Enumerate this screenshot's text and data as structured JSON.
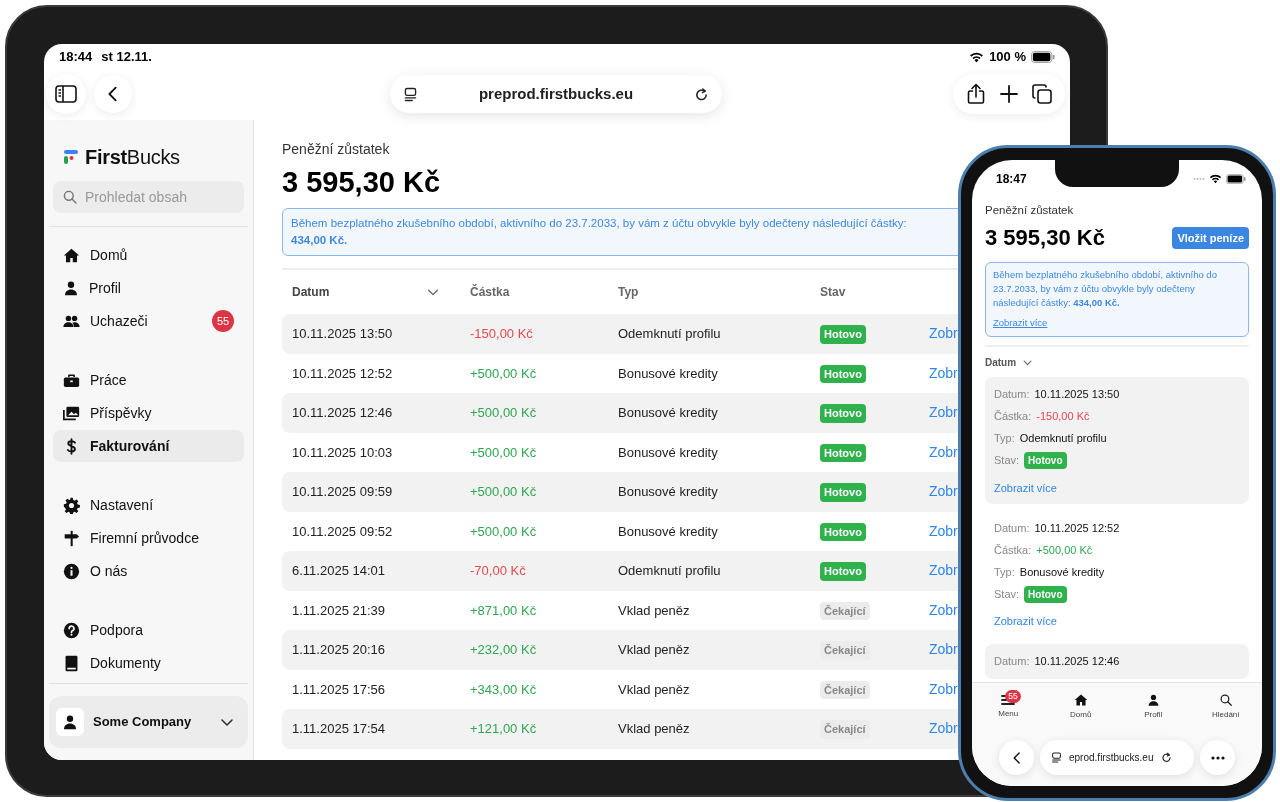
{
  "tablet": {
    "status_bar": {
      "time": "18:44",
      "date": "st 12.11.",
      "battery": "100 %"
    },
    "browser": {
      "url": "preprod.firstbucks.eu"
    },
    "sidebar": {
      "logo": {
        "first": "First",
        "second": "Bucks"
      },
      "search": {
        "placeholder": "Prohledat obsah"
      },
      "groups": [
        [
          {
            "label": "Domů",
            "selected": false
          },
          {
            "label": "Profil",
            "selected": false
          },
          {
            "label": "Uchazeči",
            "selected": false,
            "badge": "55"
          }
        ],
        [
          {
            "label": "Práce",
            "selected": false
          },
          {
            "label": "Příspěvky",
            "selected": false
          },
          {
            "label": "Fakturování",
            "selected": true
          }
        ],
        [
          {
            "label": "Nastavení",
            "selected": false
          },
          {
            "label": "Firemní průvodce",
            "selected": false
          },
          {
            "label": "O nás",
            "selected": false
          }
        ],
        [
          {
            "label": "Podpora",
            "selected": false
          },
          {
            "label": "Dokumenty",
            "selected": false
          }
        ]
      ],
      "account": "Some Company"
    },
    "main": {
      "balance_label": "Peněžní zůstatek",
      "balance": "3 595,30 Kč",
      "notice": "Během bezplatného zkušebního období, aktivního do 23.7.2033, by vám z účtu obvykle byly odečteny následující částky: **434,00 Kč.**",
      "table": {
        "columns": [
          {
            "label": "Datum",
            "sorted": true
          },
          {
            "label": "Částka",
            "sorted": false
          },
          {
            "label": "Typ",
            "sorted": false
          },
          {
            "label": "Stav",
            "sorted": false
          }
        ],
        "rows": [
          {
            "date": "10.11.2025 13:50",
            "amount": "-150,00 Kč",
            "negative": true,
            "type": "Odemknutí profilu",
            "status": "Hotovo",
            "pending": false,
            "link": "Zobr"
          },
          {
            "date": "10.11.2025 12:52",
            "amount": "+500,00 Kč",
            "negative": false,
            "type": "Bonusové kredity",
            "status": "Hotovo",
            "pending": false,
            "link": "Zobr"
          },
          {
            "date": "10.11.2025 12:46",
            "amount": "+500,00 Kč",
            "negative": false,
            "type": "Bonusové kredity",
            "status": "Hotovo",
            "pending": false,
            "link": "Zobr"
          },
          {
            "date": "10.11.2025 10:03",
            "amount": "+500,00 Kč",
            "negative": false,
            "type": "Bonusové kredity",
            "status": "Hotovo",
            "pending": false,
            "link": "Zobr"
          },
          {
            "date": "10.11.2025 09:59",
            "amount": "+500,00 Kč",
            "negative": false,
            "type": "Bonusové kredity",
            "status": "Hotovo",
            "pending": false,
            "link": "Zobr"
          },
          {
            "date": "10.11.2025 09:52",
            "amount": "+500,00 Kč",
            "negative": false,
            "type": "Bonusové kredity",
            "status": "Hotovo",
            "pending": false,
            "link": "Zobr"
          },
          {
            "date": "6.11.2025 14:01",
            "amount": "-70,00 Kč",
            "negative": true,
            "type": "Odemknutí profilu",
            "status": "Hotovo",
            "pending": false,
            "link": "Zobr"
          },
          {
            "date": "1.11.2025 21:39",
            "amount": "+871,00 Kč",
            "negative": false,
            "type": "Vklad peněz",
            "status": "Čekající",
            "pending": true,
            "link": "Zobr"
          },
          {
            "date": "1.11.2025 20:16",
            "amount": "+232,00 Kč",
            "negative": false,
            "type": "Vklad peněz",
            "status": "Čekající",
            "pending": true,
            "link": "Zobr"
          },
          {
            "date": "1.11.2025 17:56",
            "amount": "+343,00 Kč",
            "negative": false,
            "type": "Vklad peněz",
            "status": "Čekající",
            "pending": true,
            "link": "Zobr"
          },
          {
            "date": "1.11.2025 17:54",
            "amount": "+121,00 Kč",
            "negative": false,
            "type": "Vklad peněz",
            "status": "Čekající",
            "pending": true,
            "link": "Zobr"
          }
        ]
      }
    }
  },
  "phone": {
    "status_bar": {
      "time": "18:47"
    },
    "main": {
      "balance_label": "Peněžní zůstatek",
      "balance": "3 595,30 Kč",
      "deposit_button": "Vložit peníze",
      "notice": "Během bezplatného zkušebního období, aktivního do 23.7.2033, by vám z účtu obvykle byly odečteny následující částky: **434,00 Kč.**",
      "notice_link": "Zobrazit více",
      "sort": "Datum",
      "cards": [
        {
          "fields": [
            {
              "label": "Datum:",
              "value": "10.11.2025 13:50",
              "kind": "text"
            },
            {
              "label": "Částka:",
              "value": "-150,00 Kč",
              "kind": "negative"
            },
            {
              "label": "Typ:",
              "value": "Odemknutí profilu",
              "kind": "text"
            },
            {
              "label": "Stav:",
              "value": "Hotovo",
              "kind": "done"
            }
          ],
          "link": "Zobrazit více"
        },
        {
          "fields": [
            {
              "label": "Datum:",
              "value": "10.11.2025 12:52",
              "kind": "text"
            },
            {
              "label": "Částka:",
              "value": "+500,00 Kč",
              "kind": "positive"
            },
            {
              "label": "Typ:",
              "value": "Bonusové kredity",
              "kind": "text"
            },
            {
              "label": "Stav:",
              "value": "Hotovo",
              "kind": "done"
            }
          ],
          "link": "Zobrazit více"
        },
        {
          "fields": [
            {
              "label": "Datum:",
              "value": "10.11.2025 12:46",
              "kind": "text"
            }
          ]
        }
      ]
    },
    "nav": [
      {
        "label": "Menu",
        "badge": "55"
      },
      {
        "label": "Domů"
      },
      {
        "label": "Profil"
      },
      {
        "label": "Hledání"
      }
    ],
    "browser": {
      "url": "eprod.firstbucks.eu"
    }
  }
}
